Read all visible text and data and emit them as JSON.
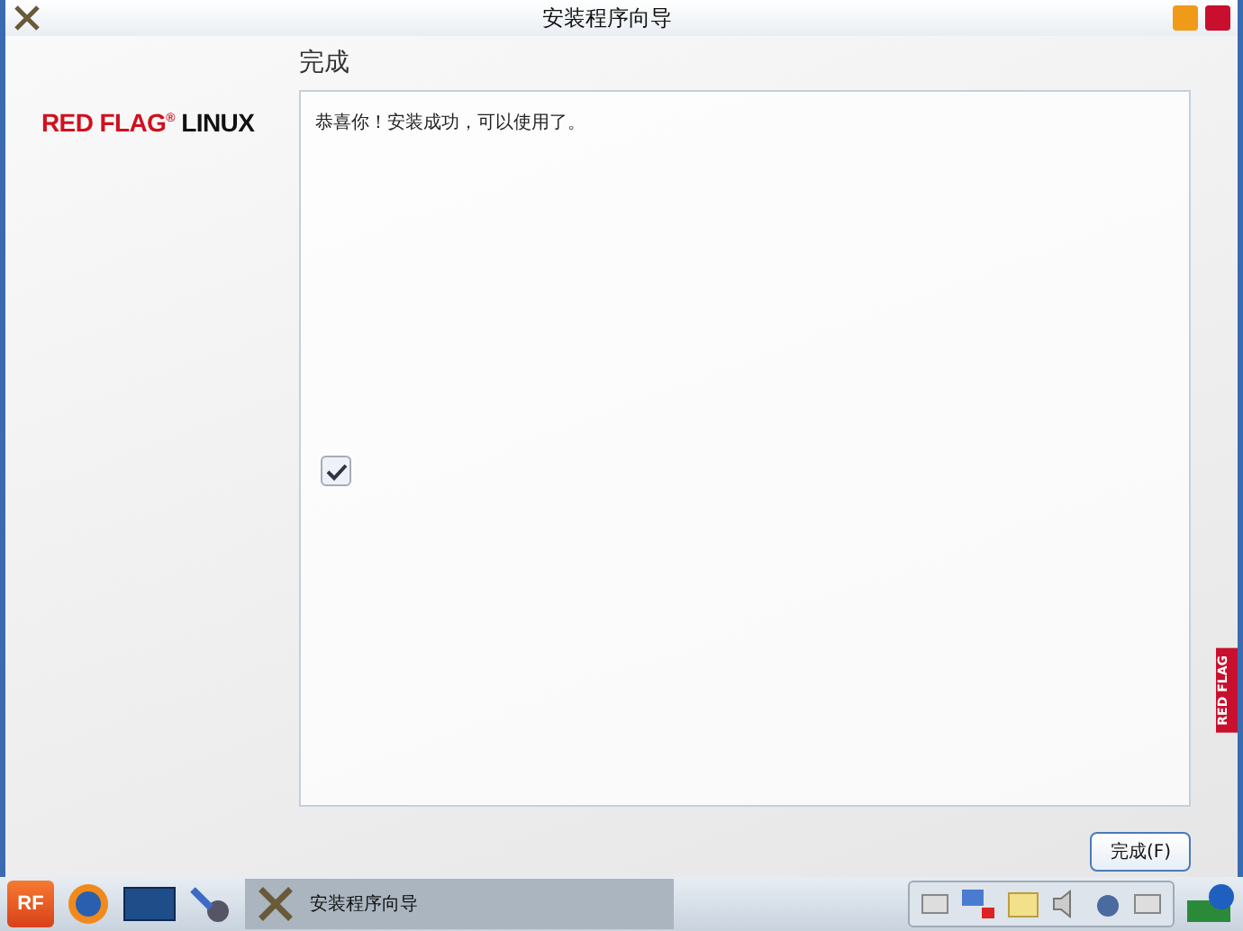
{
  "window": {
    "title": "安装程序向导"
  },
  "sidebar": {
    "logo_text": "RED FLAG",
    "logo_mark": "®",
    "logo_suffix": "LINUX"
  },
  "page": {
    "heading": "完成",
    "message": "恭喜你！安装成功，可以使用了。",
    "checkbox": {
      "checked": true
    }
  },
  "buttons": [
    {
      "label": "完成(F)"
    }
  ],
  "side_tab": {
    "label": "RED FLAG"
  },
  "taskbar": {
    "start_label": "RF",
    "task": {
      "label": "安装程序向导",
      "selected": true
    }
  }
}
